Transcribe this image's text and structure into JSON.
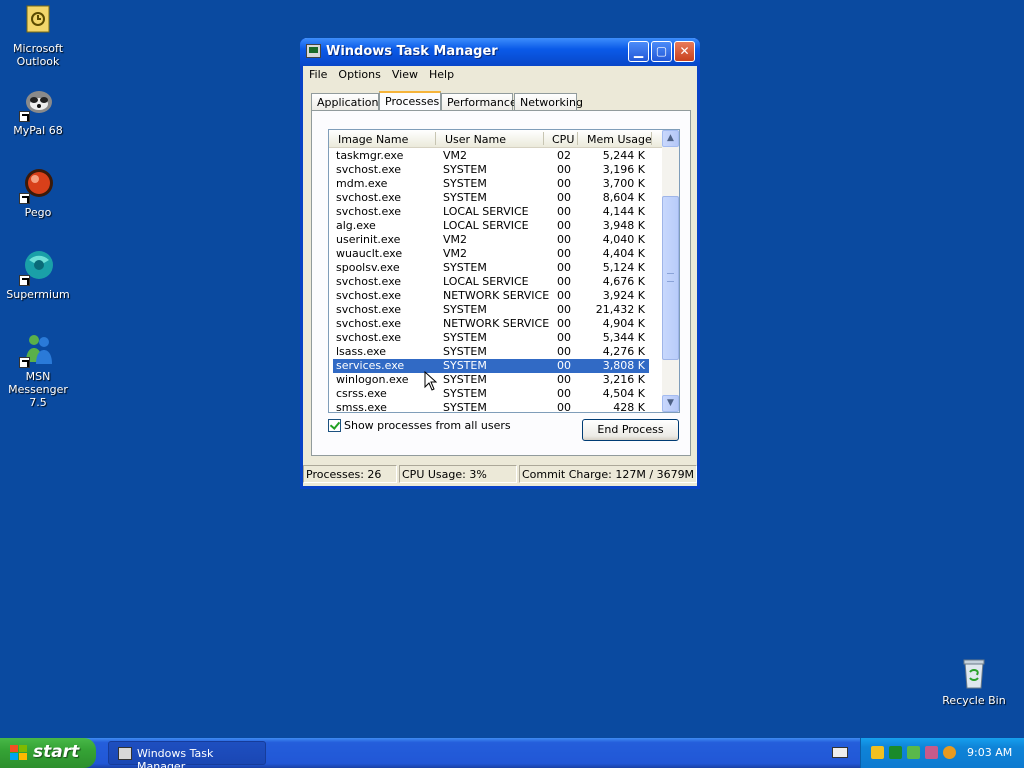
{
  "desktop": {
    "icons": [
      {
        "label": "Microsoft Outlook"
      },
      {
        "label": "MyPal 68"
      },
      {
        "label": "Pego"
      },
      {
        "label": "Supermium"
      },
      {
        "label": "MSN Messenger 7.5"
      }
    ],
    "recycle_bin": {
      "label": "Recycle Bin"
    }
  },
  "window": {
    "title": "Windows Task Manager",
    "menu": [
      "File",
      "Options",
      "View",
      "Help"
    ],
    "tabs": [
      {
        "label": "Applications",
        "active": false
      },
      {
        "label": "Processes",
        "active": true
      },
      {
        "label": "Performance",
        "active": false
      },
      {
        "label": "Networking",
        "active": false
      }
    ],
    "columns": [
      "Image Name",
      "User Name",
      "CPU",
      "Mem Usage"
    ],
    "processes": [
      {
        "name": "taskmgr.exe",
        "user": "VM2",
        "cpu": "02",
        "mem": "5,244 K"
      },
      {
        "name": "svchost.exe",
        "user": "SYSTEM",
        "cpu": "00",
        "mem": "3,196 K"
      },
      {
        "name": "mdm.exe",
        "user": "SYSTEM",
        "cpu": "00",
        "mem": "3,700 K"
      },
      {
        "name": "svchost.exe",
        "user": "SYSTEM",
        "cpu": "00",
        "mem": "8,604 K"
      },
      {
        "name": "svchost.exe",
        "user": "LOCAL SERVICE",
        "cpu": "00",
        "mem": "4,144 K"
      },
      {
        "name": "alg.exe",
        "user": "LOCAL SERVICE",
        "cpu": "00",
        "mem": "3,948 K"
      },
      {
        "name": "userinit.exe",
        "user": "VM2",
        "cpu": "00",
        "mem": "4,040 K"
      },
      {
        "name": "wuauclt.exe",
        "user": "VM2",
        "cpu": "00",
        "mem": "4,404 K"
      },
      {
        "name": "spoolsv.exe",
        "user": "SYSTEM",
        "cpu": "00",
        "mem": "5,124 K"
      },
      {
        "name": "svchost.exe",
        "user": "LOCAL SERVICE",
        "cpu": "00",
        "mem": "4,676 K"
      },
      {
        "name": "svchost.exe",
        "user": "NETWORK SERVICE",
        "cpu": "00",
        "mem": "3,924 K"
      },
      {
        "name": "svchost.exe",
        "user": "SYSTEM",
        "cpu": "00",
        "mem": "21,432 K"
      },
      {
        "name": "svchost.exe",
        "user": "NETWORK SERVICE",
        "cpu": "00",
        "mem": "4,904 K"
      },
      {
        "name": "svchost.exe",
        "user": "SYSTEM",
        "cpu": "00",
        "mem": "5,344 K"
      },
      {
        "name": "lsass.exe",
        "user": "SYSTEM",
        "cpu": "00",
        "mem": "4,276 K"
      },
      {
        "name": "services.exe",
        "user": "SYSTEM",
        "cpu": "00",
        "mem": "3,808 K",
        "selected": true
      },
      {
        "name": "winlogon.exe",
        "user": "SYSTEM",
        "cpu": "00",
        "mem": "3,216 K"
      },
      {
        "name": "csrss.exe",
        "user": "SYSTEM",
        "cpu": "00",
        "mem": "4,504 K"
      },
      {
        "name": "smss.exe",
        "user": "SYSTEM",
        "cpu": "00",
        "mem": "428 K"
      }
    ],
    "show_all_label": "Show processes from all users",
    "show_all_checked": true,
    "end_process_label": "End Process",
    "status": {
      "processes": "Processes: 26",
      "cpu": "CPU Usage: 3%",
      "commit": "Commit Charge: 127M / 3679M"
    }
  },
  "taskbar": {
    "start_label": "start",
    "task_label": "Windows Task Manager",
    "clock": "9:03 AM"
  },
  "icons": [
    "outlook-icon",
    "mypal-icon",
    "pego-icon",
    "supermium-icon",
    "msn-messenger-icon",
    "recycle-bin-icon",
    "task-manager-icon",
    "windows-flag-icon",
    "keyboard-icon",
    "security-shield-icon",
    "network-icon",
    "search-icon"
  ],
  "colors": {
    "desktop": "#0a4aa0",
    "selection": "#316ac5",
    "titlebar": "#0a5ae8",
    "start": "#35a335"
  }
}
